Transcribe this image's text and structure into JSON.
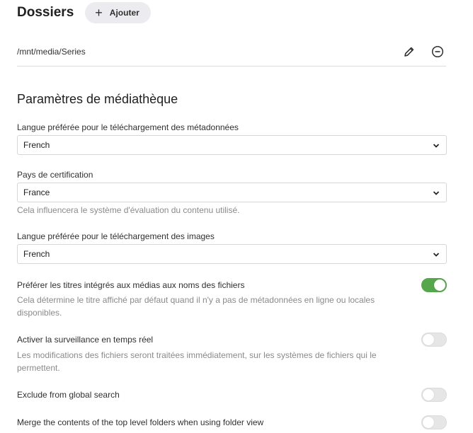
{
  "folders": {
    "title": "Dossiers",
    "add_label": "Ajouter",
    "items": [
      {
        "path": "/mnt/media/Series"
      }
    ]
  },
  "library": {
    "title": "Paramètres de médiathèque",
    "metadata_language": {
      "label": "Langue préférée pour le téléchargement des métadonnées",
      "value": "French"
    },
    "certification_country": {
      "label": "Pays de certification",
      "value": "France",
      "help": "Cela influencera le système d'évaluation du contenu utilisé."
    },
    "image_language": {
      "label": "Langue préférée pour le téléchargement des images",
      "value": "French"
    },
    "prefer_embedded_titles": {
      "label": "Préférer les titres intégrés aux médias aux noms des fichiers",
      "help_line1": "Cela détermine le titre affiché par défaut quand il n'y a pas de métadonnées en ligne ou locales",
      "help_line2": "disponibles.",
      "enabled": true
    },
    "realtime_monitoring": {
      "label": "Activer la surveillance en temps réel",
      "help_line1": "Les modifications des fichiers seront traitées immédiatement, sur les systèmes de fichiers qui le",
      "help_line2": "permettent.",
      "enabled": false
    },
    "exclude_global_search": {
      "label": "Exclude from global search",
      "enabled": false
    },
    "merge_top_level": {
      "label": "Merge the contents of the top level folders when using folder view",
      "enabled": false
    }
  },
  "colors": {
    "toggle_on": "#56a64b",
    "toggle_off": "#e6e6e6"
  }
}
